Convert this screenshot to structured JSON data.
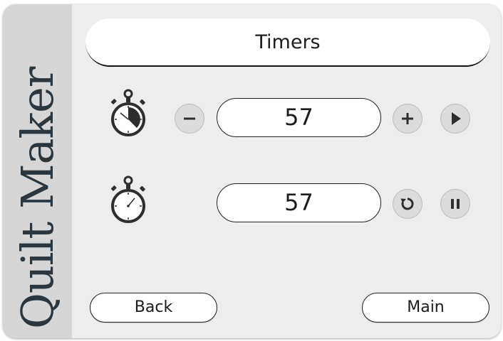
{
  "brand": {
    "text": "Quilt Maker"
  },
  "header": {
    "title": "Timers"
  },
  "timer1": {
    "value": "57",
    "icon": "stopwatch-running-icon",
    "minus_icon": "minus-icon",
    "plus_icon": "plus-icon",
    "play_icon": "play-icon"
  },
  "timer2": {
    "value": "57",
    "icon": "stopwatch-icon",
    "reset_icon": "reset-icon",
    "pause_icon": "pause-icon"
  },
  "footer": {
    "back_label": "Back",
    "main_label": "Main"
  },
  "colors": {
    "panel": "#ededed",
    "sidebar": "#d6d6d6",
    "brand": "#2b3740",
    "button": "#dcdcdc",
    "icon": "#2e2e2e"
  }
}
